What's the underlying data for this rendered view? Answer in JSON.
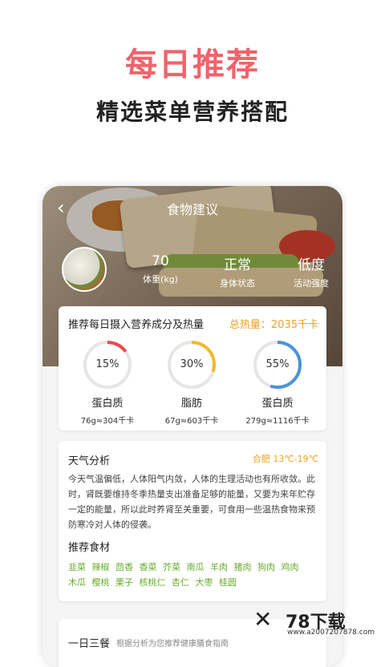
{
  "headline": "每日推荐",
  "subheadline": "精选菜单营养搭配",
  "app": {
    "back_icon": "chevron-left-icon",
    "title": "食物建议",
    "stats": [
      {
        "value": "70",
        "label": "体重(kg)"
      },
      {
        "value": "正常",
        "label": "身体状态"
      },
      {
        "value": "低度",
        "label": "活动强度"
      }
    ]
  },
  "nutrition": {
    "title": "推荐每日摄入营养成分及热量",
    "total": "总热量：2035千卡",
    "items": [
      {
        "percent": "15%",
        "fraction": 0.15,
        "color": "#e84a4a",
        "name": "蛋白质",
        "amount": "76g≈304千卡"
      },
      {
        "percent": "30%",
        "fraction": 0.3,
        "color": "#f1b92e",
        "name": "脂肪",
        "amount": "67g≈603千卡"
      },
      {
        "percent": "55%",
        "fraction": 0.55,
        "color": "#4b93d6",
        "name": "蛋白质",
        "amount": "279g≈1116千卡"
      }
    ]
  },
  "weather": {
    "title": "天气分析",
    "location": "合肥  13℃-19℃",
    "text": "今天气温偏低，人体阳气内敛，人体的生理活动也有所收敛。此时，肾既要维持冬季热量支出准备足够的能量，又要为来年贮存一定的能量，所以此时养肾至关重要，可食用一些温热食物来预防寒冷对人体的侵袭。",
    "foods_title": "推荐食材",
    "foods": [
      "韭菜",
      "辣椒",
      "茴香",
      "香菜",
      "芥菜",
      "南瓜",
      "羊肉",
      "猪肉",
      "狗肉",
      "鸡肉",
      "木瓜",
      "樱桃",
      "栗子",
      "核桃仁",
      "杏仁",
      "大枣",
      "桂圆"
    ]
  },
  "meals": {
    "title": "一日三餐",
    "subtitle": "根据分析为您推荐健康膳食指南"
  },
  "watermark": {
    "brand": "78下载",
    "url": "www.a2007207878.com"
  }
}
